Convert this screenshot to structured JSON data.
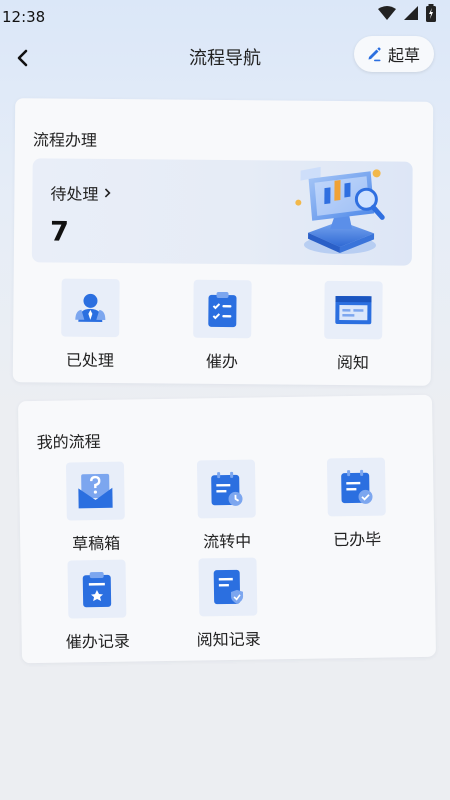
{
  "status_bar": {
    "time": "12:38"
  },
  "nav": {
    "title": "流程导航",
    "draft_label": "起草"
  },
  "process_handling": {
    "title": "流程办理",
    "pending": {
      "label": "待处理",
      "count": "7"
    },
    "items": [
      {
        "label": "已处理",
        "icon": "processed-user-icon"
      },
      {
        "label": "催办",
        "icon": "urge-clipboard-icon"
      },
      {
        "label": "阅知",
        "icon": "read-window-icon"
      }
    ]
  },
  "my_process": {
    "title": "我的流程",
    "items": [
      {
        "label": "草稿箱",
        "icon": "draft-box-icon"
      },
      {
        "label": "流转中",
        "icon": "in-transit-icon"
      },
      {
        "label": "已办毕",
        "icon": "completed-icon"
      },
      {
        "label": "催办记录",
        "icon": "urge-record-icon"
      },
      {
        "label": "阅知记录",
        "icon": "read-record-icon"
      }
    ]
  },
  "colors": {
    "accent": "#2b6fe0",
    "accent_light": "#7ca6ef",
    "card_bg": "#f8f9fb",
    "icon_bg": "#e8eef9"
  }
}
